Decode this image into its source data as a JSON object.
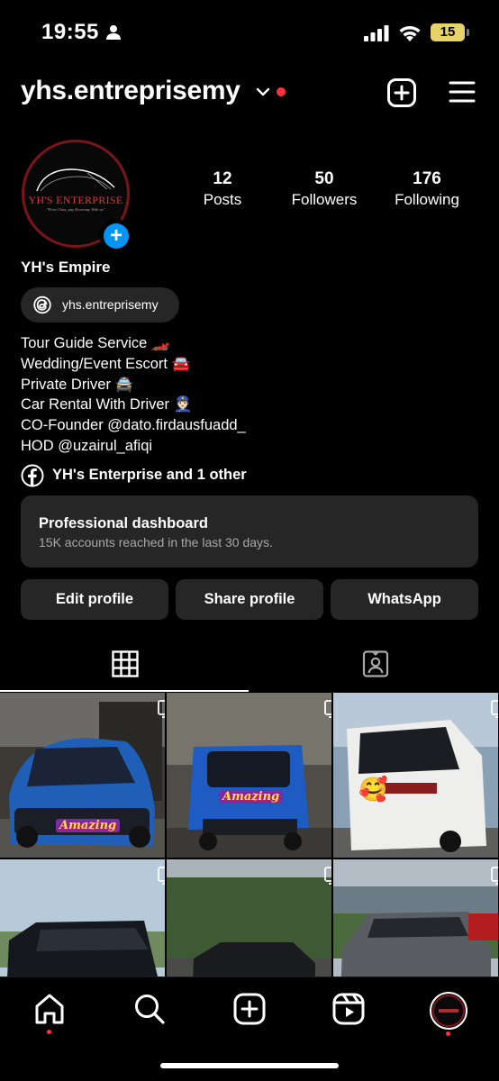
{
  "status_bar": {
    "time": "19:55",
    "battery": "15"
  },
  "header": {
    "username": "yhs.entreprisemy"
  },
  "profile": {
    "logo_text": "YH'S ENTERPRISE",
    "logo_slogan": "\"First Class, pay Economy With us\"",
    "full_name": "YH's Empire",
    "threads_handle": "yhs.entreprisemy",
    "stats": [
      {
        "value": "12",
        "label": "Posts"
      },
      {
        "value": "50",
        "label": "Followers"
      },
      {
        "value": "176",
        "label": "Following"
      }
    ],
    "bio": [
      "Tour Guide Service 🏎️",
      "Wedding/Event Escort 🚘",
      "Private Driver 🚔",
      "Car Rental With Driver 👮🏻",
      "CO-Founder @dato.firdausfuadd_",
      "HOD @uzairul_afiqi"
    ],
    "facebook_link": "YH's Enterprise and 1 other"
  },
  "dashboard": {
    "title": "Professional dashboard",
    "subtitle": "15K accounts reached in the last 30 days."
  },
  "buttons": {
    "edit": "Edit profile",
    "share": "Share profile",
    "whatsapp": "WhatsApp"
  },
  "stickers": {
    "amazing": "Amazing"
  },
  "colors": {
    "accent_blue": "#0095f6",
    "notification_red": "#ff3040",
    "surface": "#262626"
  }
}
